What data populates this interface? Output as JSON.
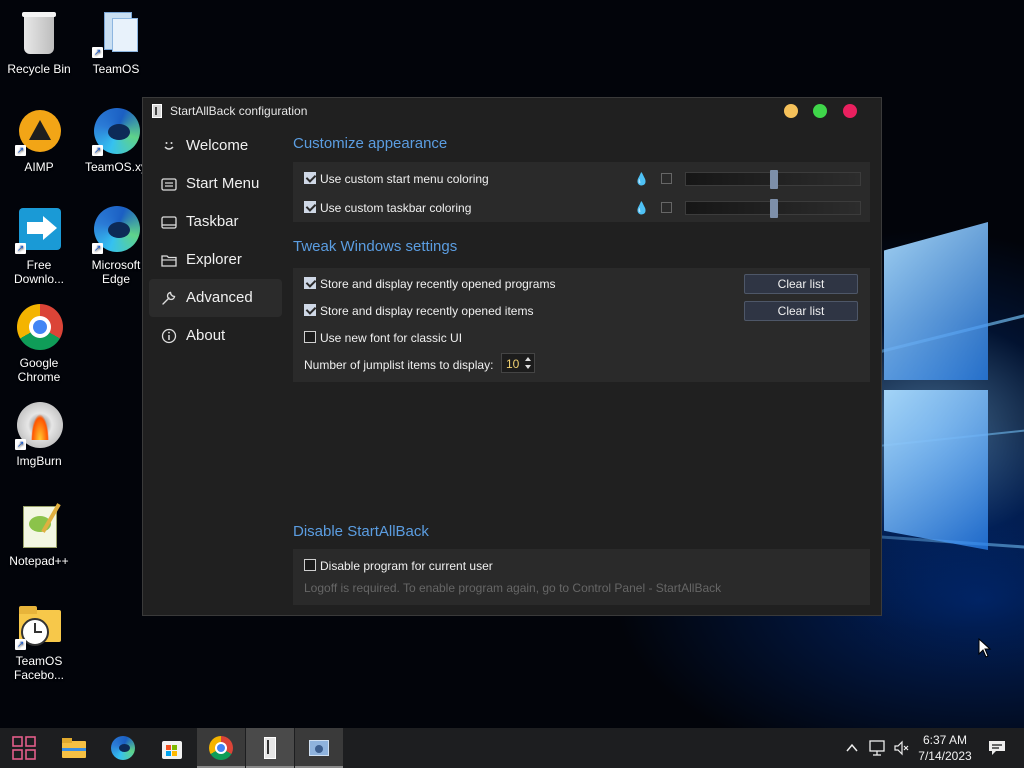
{
  "window": {
    "title": "StartAllBack configuration",
    "controls": {
      "minimize_color": "#f5c15a",
      "maximize_color": "#3fd64a",
      "close_color": "#e9205f"
    }
  },
  "nav": {
    "items": [
      {
        "label": "Welcome",
        "icon": "smile-icon"
      },
      {
        "label": "Start Menu",
        "icon": "start-menu-icon"
      },
      {
        "label": "Taskbar",
        "icon": "taskbar-icon"
      },
      {
        "label": "Explorer",
        "icon": "folder-icon"
      },
      {
        "label": "Advanced",
        "icon": "wrench-icon",
        "selected": true
      },
      {
        "label": "About",
        "icon": "info-icon"
      }
    ]
  },
  "appearance": {
    "title": "Customize appearance",
    "start_menu_coloring": {
      "label": "Use custom start menu coloring",
      "checked": true,
      "slider_level": 0.5
    },
    "taskbar_coloring": {
      "label": "Use custom taskbar coloring",
      "checked": true,
      "slider_level": 0.5
    }
  },
  "tweaks": {
    "title": "Tweak Windows settings",
    "recent_programs": {
      "label": "Store and display recently opened programs",
      "checked": true,
      "button": "Clear list"
    },
    "recent_items": {
      "label": "Store and display recently opened items",
      "checked": true,
      "button": "Clear list"
    },
    "new_font": {
      "label": "Use new font for classic UI",
      "checked": false
    },
    "jumplist": {
      "label": "Number of jumplist items to display:",
      "value": "10"
    }
  },
  "disable": {
    "title": "Disable StartAllBack",
    "checkbox_label": "Disable program for current user",
    "checked": false,
    "note": "Logoff is required. To enable program again, go to Control Panel - StartAllBack"
  },
  "desktop_icons": [
    {
      "label": "Recycle Bin",
      "icon": "recycle-bin-icon"
    },
    {
      "label": "TeamOS",
      "icon": "teamos-icon"
    },
    {
      "label": "AIMP",
      "icon": "aimp-icon"
    },
    {
      "label": "TeamOS.xy",
      "icon": "edge-icon"
    },
    {
      "label": "Free Downlo...",
      "icon": "download-icon"
    },
    {
      "label": "Microsoft Edge",
      "icon": "edge-icon"
    },
    {
      "label": "Google Chrome",
      "icon": "chrome-icon"
    },
    {
      "label": "ImgBurn",
      "icon": "imgburn-icon"
    },
    {
      "label": "Notepad++",
      "icon": "notepad-plus-icon"
    },
    {
      "label": "TeamOS Facebo...",
      "icon": "folder-clock-icon"
    }
  ],
  "taskbar": {
    "time": "6:37 AM",
    "date": "7/14/2023",
    "apps": [
      "start-icon",
      "file-explorer-icon",
      "edge-icon",
      "store-icon",
      "chrome-icon",
      "startallback-icon",
      "settings-app-icon"
    ]
  },
  "colors": {
    "accent": "#5b9de1",
    "window_bg": "#202020",
    "panel_bg": "#2a2a2a"
  }
}
